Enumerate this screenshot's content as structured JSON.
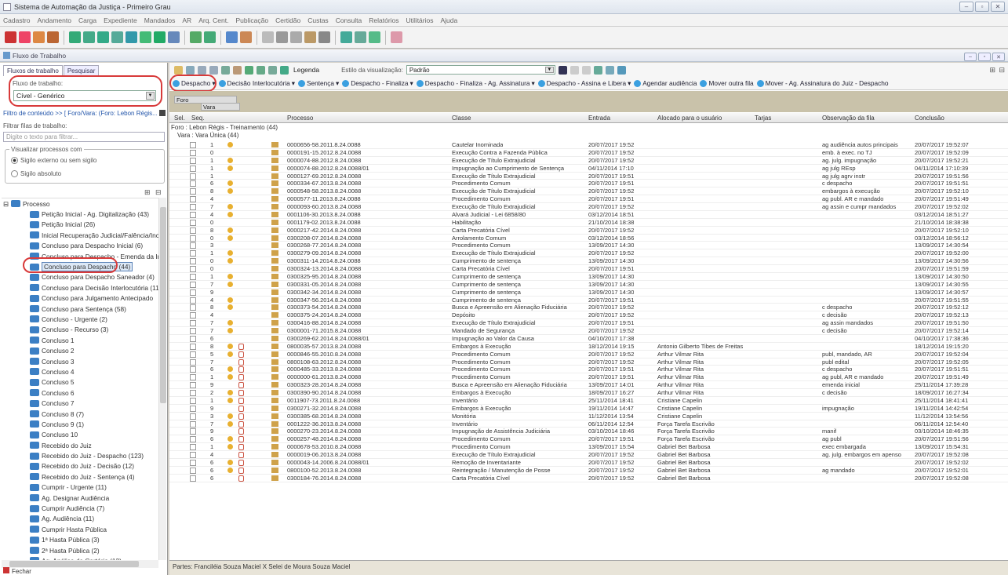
{
  "window": {
    "title": "Sistema de Automação da Justiça - Primeiro Grau"
  },
  "menu": [
    "Cadastro",
    "Andamento",
    "Carga",
    "Expediente",
    "Mandados",
    "AR",
    "Arq. Cent.",
    "Publicação",
    "Certidão",
    "Custas",
    "Consulta",
    "Relatórios",
    "Utilitários",
    "Ajuda"
  ],
  "panel": {
    "title": "Fluxo de Trabalho"
  },
  "left": {
    "tabs": [
      "Fluxos de trabalho",
      "Pesquisar"
    ],
    "fluxo_label": "Fluxo de trabalho:",
    "fluxo_value": "Cível - Genérico",
    "filtro_link": "Filtro de conteúdo >> [ Foro/Vara: (Foro: Lebon Régis...]",
    "filtrar_label": "Filtrar filas de trabalho:",
    "filtrar_placeholder": "Digite o texto para filtrar...",
    "visualizar_label": "Visualizar processos com",
    "radio1": "Sigilo externo ou sem sigilo",
    "radio2": "Sigilo absoluto",
    "tree": [
      "Processo",
      "Petição Inicial - Ag. Digitalização (43)",
      "Petição Inicial (26)",
      "Inicial Recuperação Judicial/Falência/Incidente",
      "Concluso para Despacho Inicial (6)",
      "Concluso para Despacho - Emenda da Inicial",
      "Concluso para Despacho (44)",
      "Concluso para Despacho Saneador (4)",
      "Concluso para Decisão Interlocutória (11)",
      "Concluso para Julgamento Antecipado",
      "Concluso para Sentença (58)",
      "Concluso - Urgente (2)",
      "Concluso - Recurso (3)",
      "Concluso 1",
      "Concluso 2",
      "Concluso 3",
      "Concluso 4",
      "Concluso 5",
      "Concluso 6",
      "Concluso 7",
      "Concluso 8 (7)",
      "Concluso 9 (1)",
      "Concluso 10",
      "Recebido do Juiz",
      "Recebido do Juiz - Despacho (123)",
      "Recebido do Juiz - Decisão (12)",
      "Recebido do Juiz - Sentença (4)",
      "Cumprir - Urgente (11)",
      "Ag. Designar Audiência",
      "Cumprir Audiência (7)",
      "Ag. Audiência (11)",
      "Cumprir Hasta Pública",
      "1ª Hasta Pública (3)",
      "2ª Hasta Pública (2)",
      "Ag. Análise de Cartório (12)",
      "Ag. Análise - Recursos (2)"
    ],
    "fechar": "Fechar"
  },
  "main": {
    "legenda": "Legenda",
    "estilo_label": "Estilo da visualização:",
    "estilo_value": "Padrão",
    "actions": [
      "Despacho",
      "Decisão Interlocutória",
      "Sentença",
      "Despacho - Finaliza",
      "Despacho - Finaliza - Ag. Assinatura",
      "Despacho - Assina e Libera",
      "Agendar audiência",
      "Mover outra fila",
      "Mover - Ag. Assinatura do Juiz - Despacho"
    ],
    "group_foro": "Foro",
    "group_vara": "Vara",
    "headers": {
      "sel": "Sel.",
      "seq": "Seq.",
      "processo": "Processo",
      "classe": "Classe",
      "entrada": "Entrada",
      "alocado": "Alocado para o usuário",
      "tarjas": "Tarjas",
      "obs": "Observação da fila",
      "conclusao": "Conclusão"
    },
    "group1": "Foro : Lebon Régis - Treinamento (44)",
    "group2": "Vara : Vara Única (44)",
    "rows": [
      [
        "1",
        "0000656-58.2011.8.24.0088",
        "Cautelar Inominada",
        "20/07/2017 19:52",
        "",
        "ag audiência autos principais",
        "20/07/2017 19:52:07"
      ],
      [
        "0",
        "0000191-15.2012.8.24.0088",
        "Execução Contra a Fazenda Pública",
        "20/07/2017 19:52",
        "",
        "emb. à exec. no TJ",
        "20/07/2017 19:52:09"
      ],
      [
        "1",
        "0000074-88.2012.8.24.0088",
        "Execução de Título Extrajudicial",
        "20/07/2017 19:52",
        "",
        "ag. julg. impugnação",
        "20/07/2017 19:52:21"
      ],
      [
        "1",
        "0000074-88.2012.8.24.0088/01",
        "Impugnação ao Cumprimento de Sentença",
        "04/11/2014 17:10",
        "",
        "ag julg REsp",
        "04/11/2014 17:10:39"
      ],
      [
        "1",
        "0000127-69.2012.8.24.0088",
        "Execução de Título Extrajudicial",
        "20/07/2017 19:51",
        "",
        "ag julg agrv instr",
        "20/07/2017 19:51:56"
      ],
      [
        "6",
        "0000334-67.2013.8.24.0088",
        "Procedimento Comum",
        "20/07/2017 19:51",
        "",
        "c despacho",
        "20/07/2017 19:51:51"
      ],
      [
        "8",
        "0000548-58.2013.8.24.0088",
        "Execução de Título Extrajudicial",
        "20/07/2017 19:52",
        "",
        "embargos à execução",
        "20/07/2017 19:52:10"
      ],
      [
        "4",
        "0000577-11.2013.8.24.0088",
        "Procedimento Comum",
        "20/07/2017 19:51",
        "",
        "ag publ. AR e mandado",
        "20/07/2017 19:51:49"
      ],
      [
        "7",
        "0000093-60.2013.8.24.0088",
        "Execução de Título Extrajudicial",
        "20/07/2017 19:52",
        "",
        "ag assin e cumpr mandados",
        "20/07/2017 19:52:02"
      ],
      [
        "4",
        "0001106-30.2013.8.24.0088",
        "Alvará Judicial - Lei 6858/80",
        "03/12/2014 18:51",
        "",
        "",
        "03/12/2014 18:51:27"
      ],
      [
        "0",
        "0001179-02.2013.8.24.0088",
        "Habilitação",
        "21/10/2014 18:38",
        "",
        "",
        "21/10/2014 18:38:38"
      ],
      [
        "8",
        "0000217-42.2014.8.24.0088",
        "Carta Precatória Cível",
        "20/07/2017 19:52",
        "",
        "",
        "20/07/2017 19:52:10"
      ],
      [
        "0",
        "0300208-07.2014.8.24.0088",
        "Arrolamento Comum",
        "03/12/2014 18:56",
        "",
        "",
        "03/12/2014 18:56:12"
      ],
      [
        "3",
        "0300268-77.2014.8.24.0088",
        "Procedimento Comum",
        "13/09/2017 14:30",
        "",
        "",
        "13/09/2017 14:30:54"
      ],
      [
        "1",
        "0300279-09.2014.8.24.0088",
        "Execução de Título Extrajudicial",
        "20/07/2017 19:52",
        "",
        "",
        "20/07/2017 19:52:00"
      ],
      [
        "0",
        "0300311-14.2014.8.24.0088",
        "Cumprimento de sentença",
        "13/09/2017 14:30",
        "",
        "",
        "13/09/2017 14:30:56"
      ],
      [
        "0",
        "0300324-13.2014.8.24.0088",
        "Carta Precatória Cível",
        "20/07/2017 19:51",
        "",
        "",
        "20/07/2017 19:51:59"
      ],
      [
        "1",
        "0300325-95.2014.8.24.0088",
        "Cumprimento de sentença",
        "13/09/2017 14:30",
        "",
        "",
        "13/09/2017 14:30:50"
      ],
      [
        "7",
        "0300331-05.2014.8.24.0088",
        "Cumprimento de sentença",
        "13/09/2017 14:30",
        "",
        "",
        "13/09/2017 14:30:55"
      ],
      [
        "9",
        "0300342-34.2014.8.24.0088",
        "Cumprimento de sentença",
        "13/09/2017 14:30",
        "",
        "",
        "13/09/2017 14:30:57"
      ],
      [
        "4",
        "0300347-56.2014.8.24.0088",
        "Cumprimento de sentença",
        "20/07/2017 19:51",
        "",
        "",
        "20/07/2017 19:51:55"
      ],
      [
        "8",
        "0300373-54.2014.8.24.0088",
        "Busca e Apreensão em Alienação Fiduciária",
        "20/07/2017 19:52",
        "",
        "c despacho",
        "20/07/2017 19:52:12"
      ],
      [
        "4",
        "0300375-24.2014.8.24.0088",
        "Depósito",
        "20/07/2017 19:52",
        "",
        "c decisão",
        "20/07/2017 19:52:13"
      ],
      [
        "7",
        "0300416-88.2014.8.24.0088",
        "Execução de Título Extrajudicial",
        "20/07/2017 19:51",
        "",
        "ag assin mandados",
        "20/07/2017 19:51:50"
      ],
      [
        "7",
        "0300001-71.2015.8.24.0088",
        "Mandado de Segurança",
        "20/07/2017 19:52",
        "",
        "c decisão",
        "20/07/2017 19:52:14"
      ],
      [
        "6",
        "0300269-62.2014.8.24.0088/01",
        "Impugnação ao Valor da Causa",
        "04/10/2017 17:38",
        "",
        "",
        "04/10/2017 17:38:36"
      ],
      [
        "8",
        "0800035-57.2013.8.24.0088",
        "Embargos à Execução",
        "18/12/2014 19:15",
        "Antonio Gilberto Tibes de Freitas",
        "",
        "18/12/2014 19:15:20"
      ],
      [
        "5",
        "0000846-55.2010.8.24.0088",
        "Procedimento Comum",
        "20/07/2017 19:52",
        "Arthur Vilmar Rita",
        "publ, mandado, AR",
        "20/07/2017 19:52:04"
      ],
      [
        "7",
        "0800108-63.2012.8.24.0088",
        "Procedimento Comum",
        "20/07/2017 19:52",
        "Arthur Vilmar Rita",
        "publ edital",
        "20/07/2017 19:52:05"
      ],
      [
        "6",
        "0000485-33.2013.8.24.0088",
        "Procedimento Comum",
        "20/07/2017 19:51",
        "Arthur Vilmar Rita",
        "c despacho",
        "20/07/2017 19:51:51"
      ],
      [
        "1",
        "0000000-61.2013.8.24.0088",
        "Procedimento Comum",
        "20/07/2017 19:51",
        "Arthur Vilmar Rita",
        "ag publ, AR e mandado",
        "20/07/2017 19:51:49"
      ],
      [
        "9",
        "0300323-28.2014.8.24.0088",
        "Busca e Apreensão em Alienação Fiduciária",
        "13/09/2017 14:01",
        "Arthur Vilmar Rita",
        "emenda inicial",
        "25/11/2014 17:39:28"
      ],
      [
        "2",
        "0300390-90.2014.8.24.0088",
        "Embargos à Execução",
        "18/09/2017 16:27",
        "Arthur Vilmar Rita",
        "c decisão",
        "18/09/2017 16:27:34"
      ],
      [
        "1",
        "0011907-73.2011.8.24.0088",
        "Inventário",
        "25/11/2014 18:41",
        "Cristiane Capelin",
        "",
        "25/11/2014 18:41:41"
      ],
      [
        "9",
        "0300271-32.2014.8.24.0088",
        "Embargos à Execução",
        "19/11/2014 14:47",
        "Cristiane Capelin",
        "impugnação",
        "19/11/2014 14:42:54"
      ],
      [
        "3",
        "0300385-68.2014.8.24.0088",
        "Monitória",
        "11/12/2014 13:54",
        "Cristiane Capelin",
        "",
        "11/12/2014 13:54:56"
      ],
      [
        "7",
        "0001222-36.2013.8.24.0088",
        "Inventário",
        "06/11/2014 12:54",
        "Força Tarefa Escrivão",
        "",
        "06/11/2014 12:54:40"
      ],
      [
        "9",
        "0000270-23.2014.8.24.0088",
        "Impugnação de Assistência Judiciária",
        "03/10/2014 18:46",
        "Força Tarefa Escrivão",
        "manif",
        "03/10/2014 18:46:35"
      ],
      [
        "6",
        "0000257-48.2014.8.24.0088",
        "Procedimento Comum",
        "20/07/2017 19:51",
        "Força Tarefa Escrivão",
        "ag publ",
        "20/07/2017 19:51:56"
      ],
      [
        "1",
        "0000678-53.2010.8.24.0088",
        "Procedimento Comum",
        "13/09/2017 15:54",
        "Gabriel Bet Barbosa",
        "exec embargada",
        "13/09/2017 15:54:31"
      ],
      [
        "4",
        "0000019-06.2013.8.24.0088",
        "Execução de Título Extrajudicial",
        "20/07/2017 19:52",
        "Gabriel Bet Barbosa",
        "ag. julg. embargos em apenso",
        "20/07/2017 19:52:08"
      ],
      [
        "6",
        "0000043-14.2006.8.24.0088/01",
        "Remoção de Inventariante",
        "20/07/2017 19:52",
        "Gabriel Bet Barbosa",
        "",
        "20/07/2017 19:52:02"
      ],
      [
        "6",
        "0800100-52.2013.8.24.0088",
        "Reintegração / Manutenção de Posse",
        "20/07/2017 19:52",
        "Gabriel Bet Barbosa",
        "ag mandado",
        "20/07/2017 19:52:01"
      ],
      [
        "6",
        "0300184-76.2014.8.24.0088",
        "Carta Precatória Cível",
        "20/07/2017 19:52",
        "Gabriel Bet Barbosa",
        "",
        "20/07/2017 19:52:08"
      ]
    ],
    "partes": "Partes: Franciléia Souza Maciel  X  Selei de Moura Souza Maciel"
  }
}
